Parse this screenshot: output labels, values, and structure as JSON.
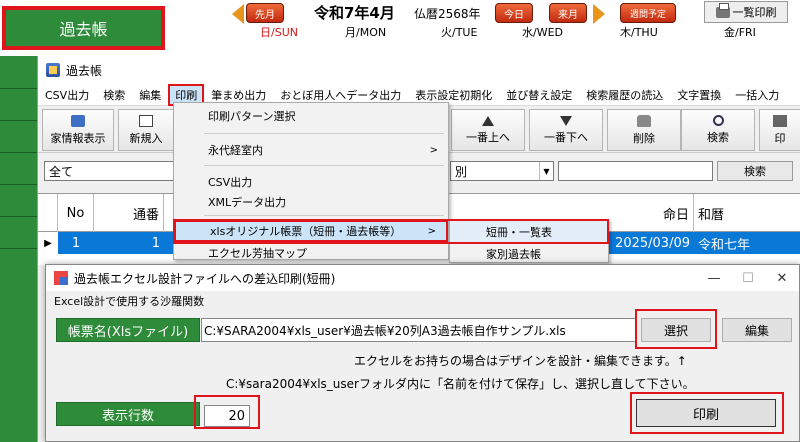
{
  "calendar": {
    "tab_label": "過去帳",
    "prev_label": "先月",
    "title": "令和7年4月",
    "buddhist": "仏暦2568年",
    "today_label": "今日",
    "next_label": "来月",
    "weekly_label": "週間予定",
    "print_list_label": "一覧印刷",
    "days": [
      "日/SUN",
      "月/MON",
      "火/TUE",
      "水/WED",
      "木/THU",
      "金/FRI"
    ]
  },
  "main_window": {
    "title": "過去帳",
    "menu": [
      "CSV出力",
      "検索",
      "編集",
      "印刷",
      "筆まめ出力",
      "おとぼ用人へデータ出力",
      "表示設定初期化",
      "並び替え設定",
      "検索履歴の読込",
      "文字置換",
      "一括入力"
    ],
    "toolbar": [
      "家情報表示",
      "新規入",
      "一番上へ",
      "一番下へ",
      "削除",
      "検索",
      "印"
    ],
    "filter": {
      "combo1": "全て",
      "combo2": "別",
      "search_button": "検索"
    },
    "grid": {
      "headers": [
        "No",
        "通番",
        "命日",
        "和暦"
      ],
      "row": {
        "no": "1",
        "tsuuban": "1",
        "meinichi": "2025/03/09",
        "wareki": "令和七年"
      }
    }
  },
  "print_menu": {
    "items": [
      "印刷パターン選択",
      "永代経室内",
      "CSV出力",
      "XMLデータ出力",
      "xlsオリジナル帳票（短冊・過去帳等）",
      "エクセル芳抽マップ"
    ],
    "submenu": [
      "短冊・一覧表",
      "家別過去帳"
    ]
  },
  "dialog": {
    "title": "過去帳エクセル設計ファイルへの差込印刷(短冊)",
    "subtitle": "Excel設計で使用する沙羅関数",
    "file_label": "帳票名(Xlsファイル)",
    "file_path": "C:¥SARA2004¥xls_user¥過去帳¥20列A3過去帳自作サンプル.xls",
    "select_button": "選択",
    "edit_button": "編集",
    "note1": "エクセルをお持ちの場合はデザインを設計・編集できます。↑",
    "note2": "C:¥sara2004¥xls_userフォルダ内に「名前を付けて保存」し、選択し直して下さい。",
    "rows_label": "表示行数",
    "rows_value": "20",
    "print_button": "印刷",
    "controls": [
      "—",
      "☐",
      "✕"
    ]
  }
}
